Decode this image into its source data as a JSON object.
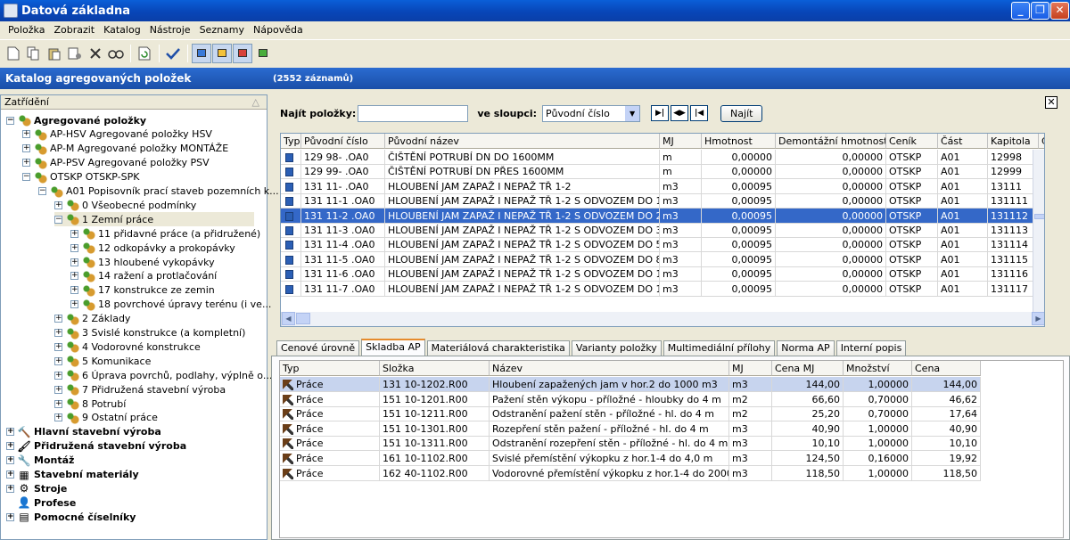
{
  "window": {
    "title": "Datová základna"
  },
  "menu": [
    "Položka",
    "Zobrazit",
    "Katalog",
    "Nástroje",
    "Seznamy",
    "Nápověda"
  ],
  "header": {
    "title": "Katalog agregovaných položek",
    "count": "(2552 záznamů)"
  },
  "tree": {
    "header": "Zatřídění",
    "items": [
      {
        "label": "Agregované položky",
        "level": 0,
        "expanded": true,
        "bold": true,
        "icon": "ap-icon"
      },
      {
        "label": "AP-HSV Agregované položky HSV",
        "level": 1,
        "expanded": false,
        "icon": "ap-icon"
      },
      {
        "label": "AP-M Agregované položky MONTÁŽE",
        "level": 1,
        "expanded": false,
        "icon": "ap-icon"
      },
      {
        "label": "AP-PSV Agregované položky PSV",
        "level": 1,
        "expanded": false,
        "icon": "ap-icon"
      },
      {
        "label": "OTSKP OTSKP-SPK",
        "level": 1,
        "expanded": true,
        "icon": "ap-icon"
      },
      {
        "label": "A01 Popisovník prací staveb pozemních k...",
        "level": 2,
        "expanded": true,
        "icon": "ap-icon"
      },
      {
        "label": "0 Všeobecné podmínky",
        "level": 3,
        "expanded": false,
        "icon": "ap-icon"
      },
      {
        "label": "1 Zemní práce",
        "level": 3,
        "expanded": true,
        "icon": "ap-icon",
        "selected": true
      },
      {
        "label": "11 přidavné práce (a přidružené)",
        "level": 4,
        "expanded": false,
        "icon": "ap-icon"
      },
      {
        "label": "12 odkopávky a prokopávky",
        "level": 4,
        "expanded": false,
        "icon": "ap-icon"
      },
      {
        "label": "13 hloubené vykopávky",
        "level": 4,
        "expanded": false,
        "icon": "ap-icon"
      },
      {
        "label": "14 ražení a protlačování",
        "level": 4,
        "expanded": false,
        "icon": "ap-icon"
      },
      {
        "label": "17 konstrukce ze zemin",
        "level": 4,
        "expanded": false,
        "icon": "ap-icon"
      },
      {
        "label": "18 povrchové úpravy terénu (i ve...",
        "level": 4,
        "expanded": false,
        "icon": "ap-icon"
      },
      {
        "label": "2 Základy",
        "level": 3,
        "expanded": false,
        "icon": "ap-icon"
      },
      {
        "label": "3 Svislé konstrukce (a kompletní)",
        "level": 3,
        "expanded": false,
        "icon": "ap-icon"
      },
      {
        "label": "4 Vodorovné konstrukce",
        "level": 3,
        "expanded": false,
        "icon": "ap-icon"
      },
      {
        "label": "5 Komunikace",
        "level": 3,
        "expanded": false,
        "icon": "ap-icon"
      },
      {
        "label": "6 Úprava povrchů, podlahy, výplně o...",
        "level": 3,
        "expanded": false,
        "icon": "ap-icon"
      },
      {
        "label": "7 Přidružená stavební výroba",
        "level": 3,
        "expanded": false,
        "icon": "ap-icon"
      },
      {
        "label": "8 Potrubí",
        "level": 3,
        "expanded": false,
        "icon": "ap-icon"
      },
      {
        "label": "9 Ostatní práce",
        "level": 3,
        "expanded": false,
        "icon": "ap-icon"
      },
      {
        "label": "Hlavní stavební výroba",
        "level": 0,
        "expanded": false,
        "bold": true,
        "icon": "hammer-icon"
      },
      {
        "label": "Přidružená stavební výroba",
        "level": 0,
        "expanded": false,
        "bold": true,
        "icon": "paint-roller-icon"
      },
      {
        "label": "Montáž",
        "level": 0,
        "expanded": false,
        "bold": true,
        "icon": "wrench-icon"
      },
      {
        "label": "Stavební materiály",
        "level": 0,
        "expanded": false,
        "bold": true,
        "icon": "brick-icon"
      },
      {
        "label": "Stroje",
        "level": 0,
        "expanded": false,
        "bold": true,
        "icon": "gear-icon"
      },
      {
        "label": "Profese",
        "level": 0,
        "expanded": null,
        "bold": true,
        "icon": "person-icon"
      },
      {
        "label": "Pomocné číselníky",
        "level": 0,
        "expanded": false,
        "bold": true,
        "icon": "table-icon"
      }
    ]
  },
  "search": {
    "label": "Najít položky:",
    "value": "",
    "column_label": "ve sloupci:",
    "column_value": "Původní číslo",
    "find_button": "Najít"
  },
  "grid": {
    "columns": [
      "Typ",
      "Původní číslo",
      "Původní název",
      "MJ",
      "Hmotnost",
      "Demontážní hmotnost",
      "Ceník",
      "Část",
      "Kapitola",
      "Čís"
    ],
    "rows": [
      [
        "",
        "129 98-    .OA0",
        "ČIŠTĚNÍ POTRUBÍ DN DO 1600MM",
        "m",
        "0,00000",
        "0,00000",
        "OTSKP",
        "A01",
        "12998"
      ],
      [
        "",
        "129 99-    .OA0",
        "ČIŠTĚNÍ POTRUBÍ DN PŘES 1600MM",
        "m",
        "0,00000",
        "0,00000",
        "OTSKP",
        "A01",
        "12999"
      ],
      [
        "",
        "131 11-    .OA0",
        "HLOUBENÍ JAM ZAPAŽ I NEPAŽ TŘ 1-2",
        "m3",
        "0,00095",
        "0,00000",
        "OTSKP",
        "A01",
        "13111"
      ],
      [
        "",
        "131 11-1   .OA0",
        "HLOUBENÍ JAM ZAPAŽ I NEPAŽ TŘ 1-2 S ODVOZEM DO 1KM",
        "m3",
        "0,00095",
        "0,00000",
        "OTSKP",
        "A01",
        "131111"
      ],
      [
        "",
        "131 11-2   .OA0",
        "HLOUBENÍ JAM ZAPAŽ I NEPAŽ TŘ 1-2 S ODVOZEM DO 2KM",
        "m3",
        "0,00095",
        "0,00000",
        "OTSKP",
        "A01",
        "131112"
      ],
      [
        "",
        "131 11-3   .OA0",
        "HLOUBENÍ JAM ZAPAŽ I NEPAŽ TŘ 1-2 S ODVOZEM DO 3KM",
        "m3",
        "0,00095",
        "0,00000",
        "OTSKP",
        "A01",
        "131113"
      ],
      [
        "",
        "131 11-4   .OA0",
        "HLOUBENÍ JAM ZAPAŽ I NEPAŽ TŘ 1-2 S ODVOZEM DO 5KM",
        "m3",
        "0,00095",
        "0,00000",
        "OTSKP",
        "A01",
        "131114"
      ],
      [
        "",
        "131 11-5   .OA0",
        "HLOUBENÍ JAM ZAPAŽ I NEPAŽ TŘ 1-2 S ODVOZEM DO 8KM",
        "m3",
        "0,00095",
        "0,00000",
        "OTSKP",
        "A01",
        "131115"
      ],
      [
        "",
        "131 11-6   .OA0",
        "HLOUBENÍ JAM ZAPAŽ I NEPAŽ TŘ 1-2 S ODVOZEM DO 12KM",
        "m3",
        "0,00095",
        "0,00000",
        "OTSKP",
        "A01",
        "131116"
      ],
      [
        "",
        "131 11-7   .OA0",
        "HLOUBENÍ JAM ZAPAŽ I NEPAŽ TŘ 1-2 S ODVOZEM DO 16KM",
        "m3",
        "0,00095",
        "0,00000",
        "OTSKP",
        "A01",
        "131117"
      ]
    ],
    "selected_row": 4
  },
  "tabs": [
    "Cenové úrovně",
    "Skladba AP",
    "Materiálová charakteristika",
    "Varianty položky",
    "Multimediální přílohy",
    "Norma AP",
    "Interní popis"
  ],
  "active_tab": 1,
  "composition": {
    "columns": [
      "Typ",
      "Složka",
      "Název",
      "MJ",
      "Cena MJ",
      "Množství",
      "Cena"
    ],
    "rows": [
      [
        "Práce",
        "131 10-1202.R00",
        "Hloubení zapažených jam v hor.2 do 1000 m3",
        "m3",
        "144,00",
        "1,00000",
        "144,00"
      ],
      [
        "Práce",
        "151 10-1201.R00",
        "Pažení stěn výkopu - příložné - hloubky do 4 m",
        "m2",
        "66,60",
        "0,70000",
        "46,62"
      ],
      [
        "Práce",
        "151 10-1211.R00",
        "Odstranění pažení stěn - příložné - hl. do 4 m",
        "m2",
        "25,20",
        "0,70000",
        "17,64"
      ],
      [
        "Práce",
        "151 10-1301.R00",
        "Rozepření stěn pažení - příložné -  hl. do 4 m",
        "m3",
        "40,90",
        "1,00000",
        "40,90"
      ],
      [
        "Práce",
        "151 10-1311.R00",
        "Odstranění rozepření stěn - příložné - hl. do 4 m",
        "m3",
        "10,10",
        "1,00000",
        "10,10"
      ],
      [
        "Práce",
        "161 10-1102.R00",
        "Svislé přemístění výkopku z hor.1-4 do 4,0 m",
        "m3",
        "124,50",
        "0,16000",
        "19,92"
      ],
      [
        "Práce",
        "162 40-1102.R00",
        "Vodorovné přemístění výkopku z hor.1-4 do 2000 m",
        "m3",
        "118,50",
        "1,00000",
        "118,50"
      ]
    ],
    "selected_row": 0
  }
}
